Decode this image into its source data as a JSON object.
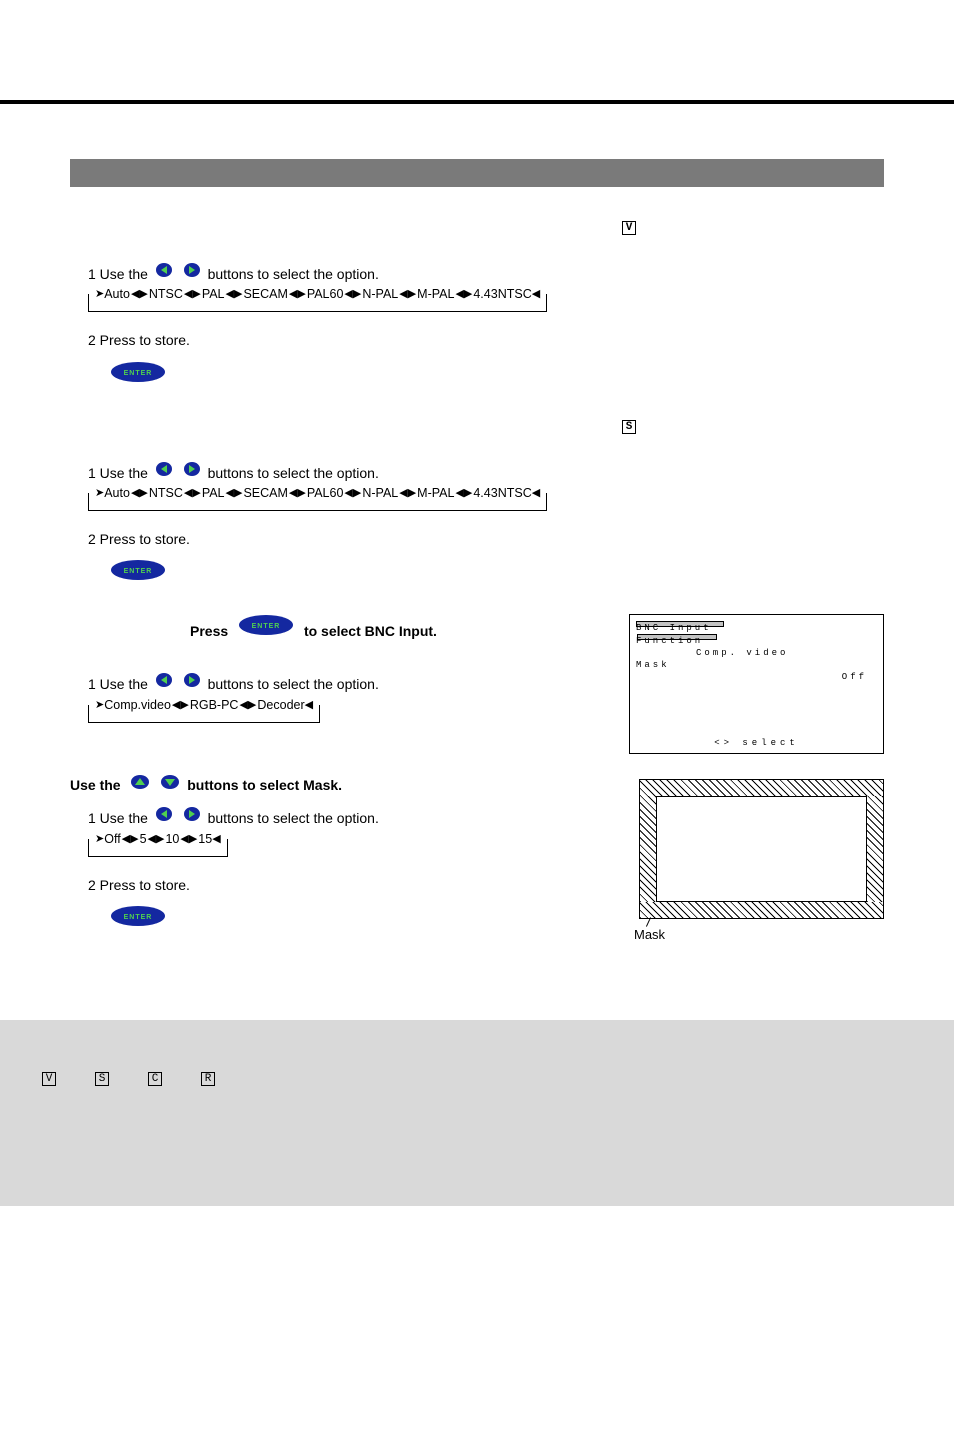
{
  "header_rule": true,
  "sections": {
    "video_input": {
      "label_prefix": "",
      "box_letter": "V",
      "step1_prefix": "1 Use the",
      "step1_suffix": "buttons to select the option.",
      "sequence": [
        "Auto",
        "NTSC",
        "PAL",
        "SECAM",
        "PAL60",
        "N-PAL",
        "M-PAL",
        "4.43NTSC"
      ],
      "step2_prefix": "2 Press",
      "step2_enter_label": "ENTER",
      "step2_suffix": "to store."
    },
    "s_input": {
      "box_letter": "S",
      "step1_prefix": "1 Use the",
      "step1_suffix": "buttons to select the option.",
      "sequence": [
        "Auto",
        "NTSC",
        "PAL",
        "SECAM",
        "PAL60",
        "N-PAL",
        "M-PAL",
        "4.43NTSC"
      ],
      "step2_prefix": "2 Press",
      "step2_enter_label": "ENTER",
      "step2_suffix": "to store."
    },
    "bnc_input": {
      "title_lead": "Press",
      "title_enter_label": "ENTER",
      "title_trail": "to select BNC Input.",
      "step1_prefix": "1 Use the",
      "step1_suffix": "buttons to select the option.",
      "sequence": [
        "Comp.video",
        "RGB-PC",
        "Decoder"
      ]
    },
    "mask": {
      "intro_prefix": "Use the",
      "intro_suffix": "buttons to select Mask.",
      "step1_prefix": "1 Use the",
      "step1_suffix": "buttons to select the option.",
      "sequence": [
        "Off",
        "5",
        "10",
        "15"
      ],
      "step2_prefix": "2 Press",
      "step2_enter_label": "ENTER",
      "step2_suffix": "to store.",
      "callout": "Mask"
    }
  },
  "ref_panel": {
    "l1": "BNC Input",
    "l2": "Function",
    "l2v": "Comp. video",
    "l3": "Mask",
    "l3v": "Off",
    "footer": "<> select"
  },
  "footer_bar": {
    "intro": "",
    "items": [
      {
        "box": "V",
        "label": ""
      },
      {
        "box": "S",
        "label": ""
      },
      {
        "box": "C",
        "label": ""
      },
      {
        "box": "R",
        "label": ""
      }
    ]
  }
}
